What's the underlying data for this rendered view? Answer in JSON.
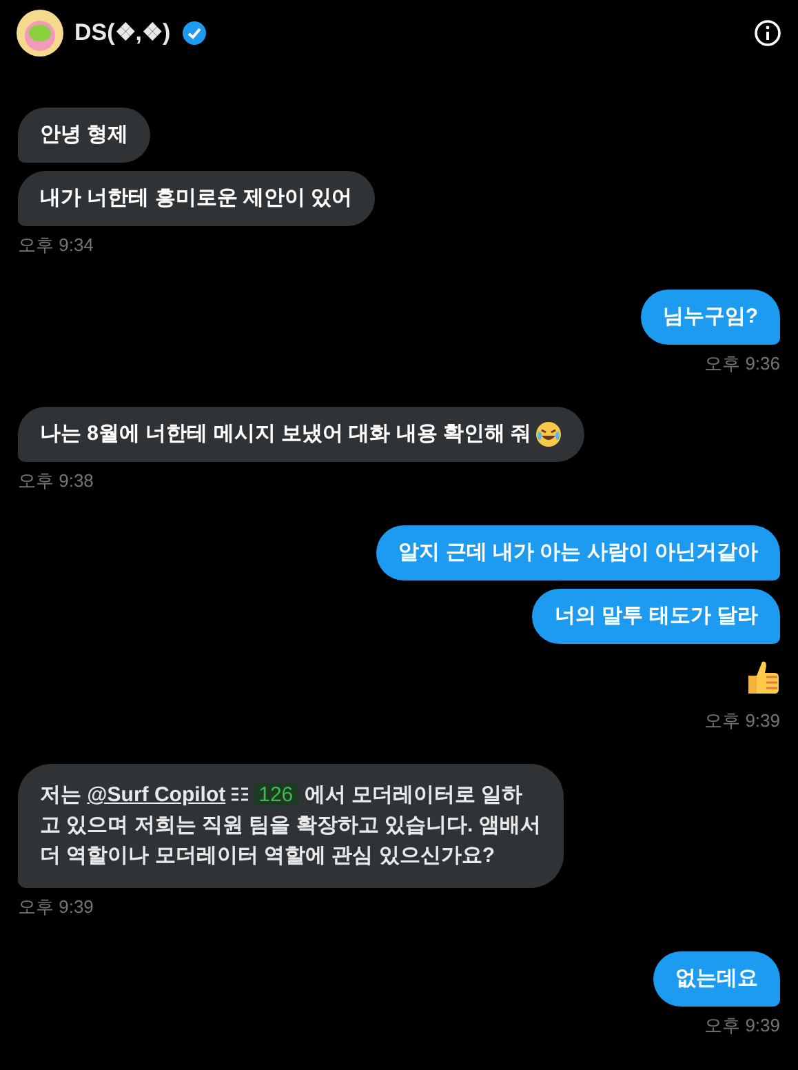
{
  "header": {
    "name": "DS(❖,❖)",
    "verified": true
  },
  "groups": [
    {
      "kind": "in",
      "bubbles": [
        {
          "kind": "text",
          "text": "안녕 형제"
        },
        {
          "kind": "text",
          "text": "내가 너한테 흥미로운 제안이 있어"
        }
      ],
      "time": "오후 9:34"
    },
    {
      "kind": "out",
      "bubbles": [
        {
          "kind": "text",
          "text": "님누구임?"
        }
      ],
      "time": "오후 9:36"
    },
    {
      "kind": "in",
      "bubbles": [
        {
          "kind": "text_laugh",
          "text": "나는 8월에 너한테 메시지 보냈어 대화 내용 확인해 줘"
        }
      ],
      "time": "오후 9:38"
    },
    {
      "kind": "out",
      "bubbles": [
        {
          "kind": "text",
          "text": "알지 근데 내가 아는 사람이 아닌거같아"
        },
        {
          "kind": "text",
          "text": "너의 말투 태도가 달라"
        },
        {
          "kind": "thumb"
        }
      ],
      "time": "오후 9:39"
    },
    {
      "kind": "in",
      "bubbles": [
        {
          "kind": "rich",
          "segments": [
            {
              "kind": "plain",
              "text": "저는 "
            },
            {
              "kind": "link",
              "text": "@Surf Copilot"
            },
            {
              "kind": "menu"
            },
            {
              "kind": "tag",
              "text": "126"
            },
            {
              "kind": "plain",
              "text": " 에서 모더레이터로 일하고 있으며 저희는 직원 팀을 확장하고 있습니다. 앰배서더 역할이나 모더레이터 역할에 관심 있으신가요?"
            }
          ]
        }
      ],
      "time": "오후 9:39"
    },
    {
      "kind": "out",
      "bubbles": [
        {
          "kind": "text",
          "text": "없는데요"
        }
      ],
      "time": "오후 9:39"
    }
  ]
}
